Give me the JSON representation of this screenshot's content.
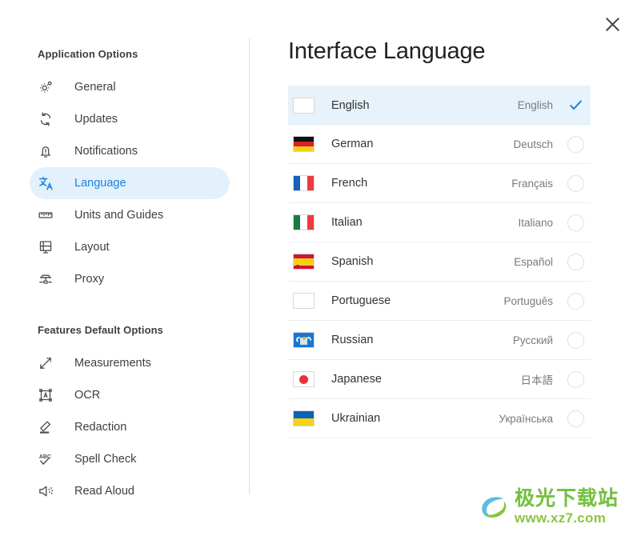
{
  "window": {
    "close_label": "Close"
  },
  "sidebar": {
    "sections": [
      {
        "title": "Application Options",
        "items": [
          {
            "label": "General",
            "icon": "gear-icon",
            "active": false
          },
          {
            "label": "Updates",
            "icon": "refresh-icon",
            "active": false
          },
          {
            "label": "Notifications",
            "icon": "bell-icon",
            "active": false
          },
          {
            "label": "Language",
            "icon": "translate-icon",
            "active": true
          },
          {
            "label": "Units and Guides",
            "icon": "ruler-icon",
            "active": false
          },
          {
            "label": "Layout",
            "icon": "layout-icon",
            "active": false
          },
          {
            "label": "Proxy",
            "icon": "proxy-server-icon",
            "active": false
          }
        ]
      },
      {
        "title": "Features Default Options",
        "items": [
          {
            "label": "Measurements",
            "icon": "measure-arrow-icon",
            "active": false
          },
          {
            "label": "OCR",
            "icon": "ocr-icon",
            "active": false
          },
          {
            "label": "Redaction",
            "icon": "eraser-icon",
            "active": false
          },
          {
            "label": "Spell Check",
            "icon": "abc-check-icon",
            "active": false
          },
          {
            "label": "Read Aloud",
            "icon": "megaphone-icon",
            "active": false
          }
        ]
      }
    ]
  },
  "main": {
    "title": "Interface Language",
    "languages": [
      {
        "name": "English",
        "native": "English",
        "flag": "us-uk",
        "selected": true
      },
      {
        "name": "German",
        "native": "Deutsch",
        "flag": "de",
        "selected": false
      },
      {
        "name": "French",
        "native": "Français",
        "flag": "fr",
        "selected": false
      },
      {
        "name": "Italian",
        "native": "Italiano",
        "flag": "it",
        "selected": false
      },
      {
        "name": "Spanish",
        "native": "Español",
        "flag": "es",
        "selected": false
      },
      {
        "name": "Portuguese",
        "native": "Português",
        "flag": "br-pt",
        "selected": false
      },
      {
        "name": "Russian",
        "native": "Русский",
        "flag": "ru",
        "selected": false
      },
      {
        "name": "Japanese",
        "native": "日本語",
        "flag": "jp",
        "selected": false
      },
      {
        "name": "Ukrainian",
        "native": "Українська",
        "flag": "ua",
        "selected": false
      }
    ]
  },
  "watermark": {
    "site_name": "极光下载站",
    "url": "www.xz7.com"
  },
  "colors": {
    "accent": "#1a80e0",
    "selected_row_bg": "#e7f2fb",
    "sidebar_active_bg": "#e3f1fd",
    "text_primary": "#333333",
    "text_secondary": "#7a7a7a",
    "divider": "#ececec",
    "watermark_green": "#8bc53f"
  }
}
